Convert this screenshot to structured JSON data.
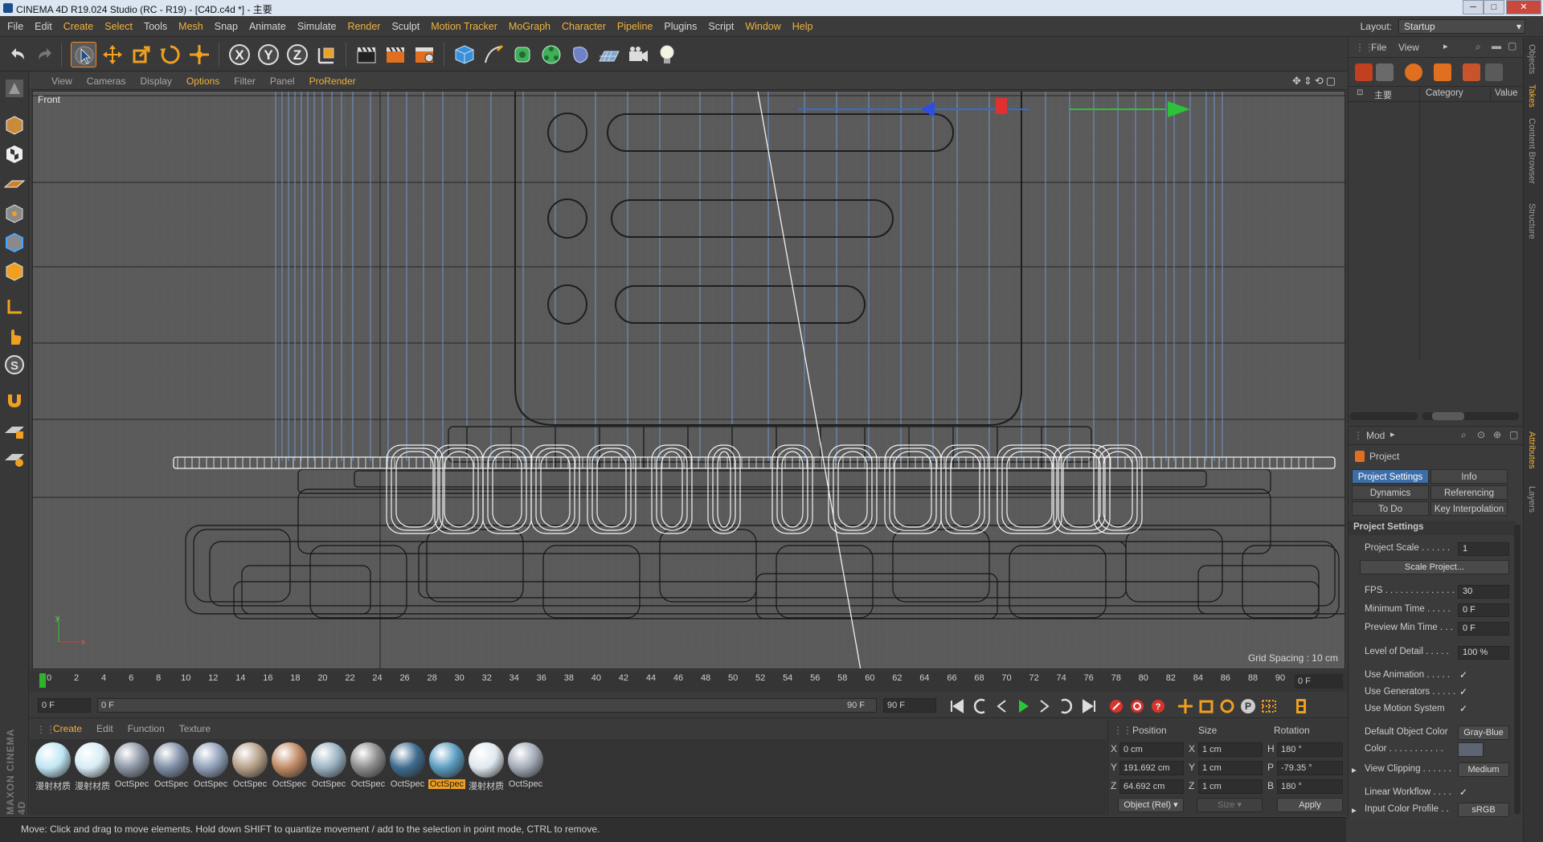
{
  "window": {
    "title": "CINEMA 4D R19.024 Studio (RC - R19) - [C4D.c4d *] - 主要",
    "minimize": "─",
    "maximize": "□",
    "close": "✕"
  },
  "menubar": {
    "items": [
      "File",
      "Edit",
      "Create",
      "Select",
      "Tools",
      "Mesh",
      "Snap",
      "Animate",
      "Simulate",
      "Render",
      "Sculpt",
      "Motion Tracker",
      "MoGraph",
      "Character",
      "Pipeline",
      "Plugins",
      "Script",
      "Window",
      "Help"
    ],
    "layout_label": "Layout:",
    "layout_value": "Startup"
  },
  "viewport": {
    "menu": [
      "View",
      "Cameras",
      "Display",
      "Options",
      "Filter",
      "Panel",
      "ProRender"
    ],
    "label": "Front",
    "grid_spacing": "Grid Spacing : 10 cm",
    "axis_y": "y",
    "axis_x": "x"
  },
  "timeline": {
    "ticks": [
      "0",
      "2",
      "4",
      "6",
      "8",
      "10",
      "12",
      "14",
      "16",
      "18",
      "20",
      "22",
      "24",
      "26",
      "28",
      "30",
      "32",
      "34",
      "36",
      "38",
      "40",
      "42",
      "44",
      "46",
      "48",
      "50",
      "52",
      "54",
      "56",
      "58",
      "60",
      "62",
      "64",
      "66",
      "68",
      "70",
      "72",
      "74",
      "76",
      "78",
      "80",
      "82",
      "84",
      "86",
      "88",
      "90"
    ],
    "current_frame": "0 F"
  },
  "transport": {
    "start_field": "0 F",
    "range_start": "0 F",
    "range_end": "90 F",
    "end_field": "90 F"
  },
  "materials": {
    "menu": [
      "Create",
      "Edit",
      "Function",
      "Texture"
    ],
    "items": [
      {
        "label": "漫射材质",
        "color": "#bfe6f3"
      },
      {
        "label": "漫射材质",
        "color": "#d7ecf6"
      },
      {
        "label": "OctSpec",
        "color": "#8c95a4"
      },
      {
        "label": "OctSpec",
        "color": "#7f8ea6"
      },
      {
        "label": "OctSpec",
        "color": "#90a0b8"
      },
      {
        "label": "OctSpec",
        "color": "#b6a088"
      },
      {
        "label": "OctSpec",
        "color": "#c08a64"
      },
      {
        "label": "OctSpec",
        "color": "#9ab2c2"
      },
      {
        "label": "OctSpec",
        "color": "#8c8c8c"
      },
      {
        "label": "OctSpec",
        "color": "#3f6c8e"
      },
      {
        "label": "OctSpec",
        "color": "#5a9cc0"
      },
      {
        "label": "漫射材质",
        "color": "#dfe8f0"
      },
      {
        "label": "OctSpec",
        "color": "#a3abb8"
      }
    ],
    "selected_index": 10
  },
  "coordinates": {
    "headers": [
      "Position",
      "Size",
      "Rotation"
    ],
    "rows": [
      {
        "axis": "X",
        "pos": "0 cm",
        "size_axis": "X",
        "size": "1 cm",
        "rot_axis": "H",
        "rot": "180 °"
      },
      {
        "axis": "Y",
        "pos": "191.692 cm",
        "size_axis": "Y",
        "size": "1 cm",
        "rot_axis": "P",
        "rot": "-79.35 °"
      },
      {
        "axis": "Z",
        "pos": "64.692 cm",
        "size_axis": "Z",
        "size": "1 cm",
        "rot_axis": "B",
        "rot": "180 °"
      }
    ],
    "mode": "Object (Rel)",
    "size_mode": "Size",
    "apply": "Apply"
  },
  "status": "Move: Click and drag to move elements. Hold down SHIFT to quantize movement / add to the selection in point mode, CTRL to remove.",
  "brand": "MAXON CINEMA 4D",
  "object_manager": {
    "menu": [
      "File",
      "View"
    ],
    "root": "主要",
    "col_category": "Category",
    "col_value": "Value"
  },
  "attributes": {
    "mode_label": "Mod",
    "section": "Project",
    "tabs": [
      "Project Settings",
      "Info",
      "Dynamics",
      "Referencing",
      "To Do",
      "Key Interpolation"
    ],
    "active_tab": "Project Settings",
    "heading": "Project Settings",
    "rows": [
      {
        "label": "Project Scale . . . . . .",
        "value": "1"
      },
      {
        "label": "FPS . . . . . . . . . . . . . .",
        "value": "30"
      },
      {
        "label": "Minimum Time . . . . .",
        "value": "0 F"
      },
      {
        "label": "Preview Min Time . . .",
        "value": "0 F"
      },
      {
        "label": "Level of Detail . . . . .",
        "value": "100 %"
      }
    ],
    "scale_button": "Scale Project...",
    "checks": [
      {
        "label": "Use Animation . . . . .",
        "value": "✓"
      },
      {
        "label": "Use Generators . . . . .",
        "value": "✓"
      },
      {
        "label": "Use Motion System",
        "value": "✓"
      }
    ],
    "default_color_label": "Default Object Color",
    "default_color_value": "Gray-Blue",
    "color_label": "Color . . . . . . . . . . .",
    "view_clipping_label": "View Clipping . . . . . .",
    "view_clipping_value": "Medium",
    "linear_workflow_label": "Linear Workflow . . . .",
    "linear_workflow_value": "✓",
    "input_profile_label": "Input Color Profile . .",
    "input_profile_value": "sRGB"
  },
  "side_tabs": [
    "Objects",
    "Takes",
    "Content Browser",
    "Structure",
    "Attributes",
    "Layers"
  ]
}
